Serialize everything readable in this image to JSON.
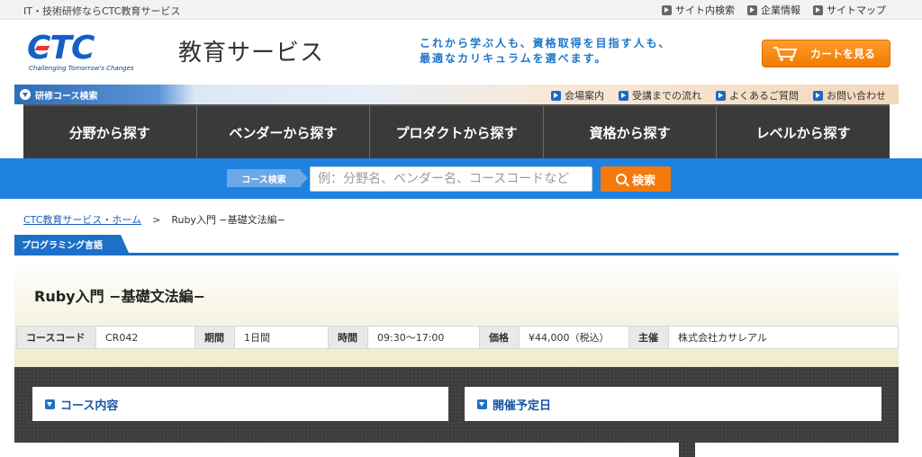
{
  "topbar": {
    "tagline": "IT・技術研修ならCTC教育サービス",
    "links": [
      "サイト内検索",
      "企業情報",
      "サイトマップ"
    ]
  },
  "header": {
    "logo_text": "CTC",
    "logo_slogan": "Challenging Tomorrow's Changes",
    "service_name": "教育サービス",
    "catch_line1": "これから学ぶ人も、資格取得を目指す人も、",
    "catch_line2": "最適なカリキュラムを選べます。",
    "cart_label": "カートを見る"
  },
  "subnav": {
    "course_search_label": "研修コース検索",
    "links": [
      "会場案内",
      "受講までの流れ",
      "よくあるご質問",
      "お問い合わせ"
    ]
  },
  "mainnav": {
    "items": [
      "分野から探す",
      "ベンダーから探す",
      "プロダクトから探す",
      "資格から探す",
      "レベルから探す"
    ]
  },
  "search": {
    "label": "コース検索",
    "placeholder": "例：分野名、ベンダー名、コースコードなど",
    "button": "検索"
  },
  "breadcrumb": {
    "home": "CTC教育サービス・ホーム",
    "separator": ">",
    "current": "Ruby入門 −基礎文法編−"
  },
  "category": "プログラミング言語",
  "course": {
    "title": "Ruby入門 −基礎文法編−",
    "code_label": "コースコード",
    "code": "CR042",
    "duration_label": "期間",
    "duration": "1日間",
    "time_label": "時間",
    "time": "09:30～17:00",
    "price_label": "価格",
    "price": "¥44,000（税込）",
    "organizer_label": "主催",
    "organizer": "株式会社カサレアル"
  },
  "sections": {
    "content": "コース内容",
    "schedule": "開催予定日"
  },
  "colors": {
    "brand_blue": "#1f82e0",
    "cart_orange": "#f47a0c",
    "nav_dark": "#3a3a3a"
  }
}
